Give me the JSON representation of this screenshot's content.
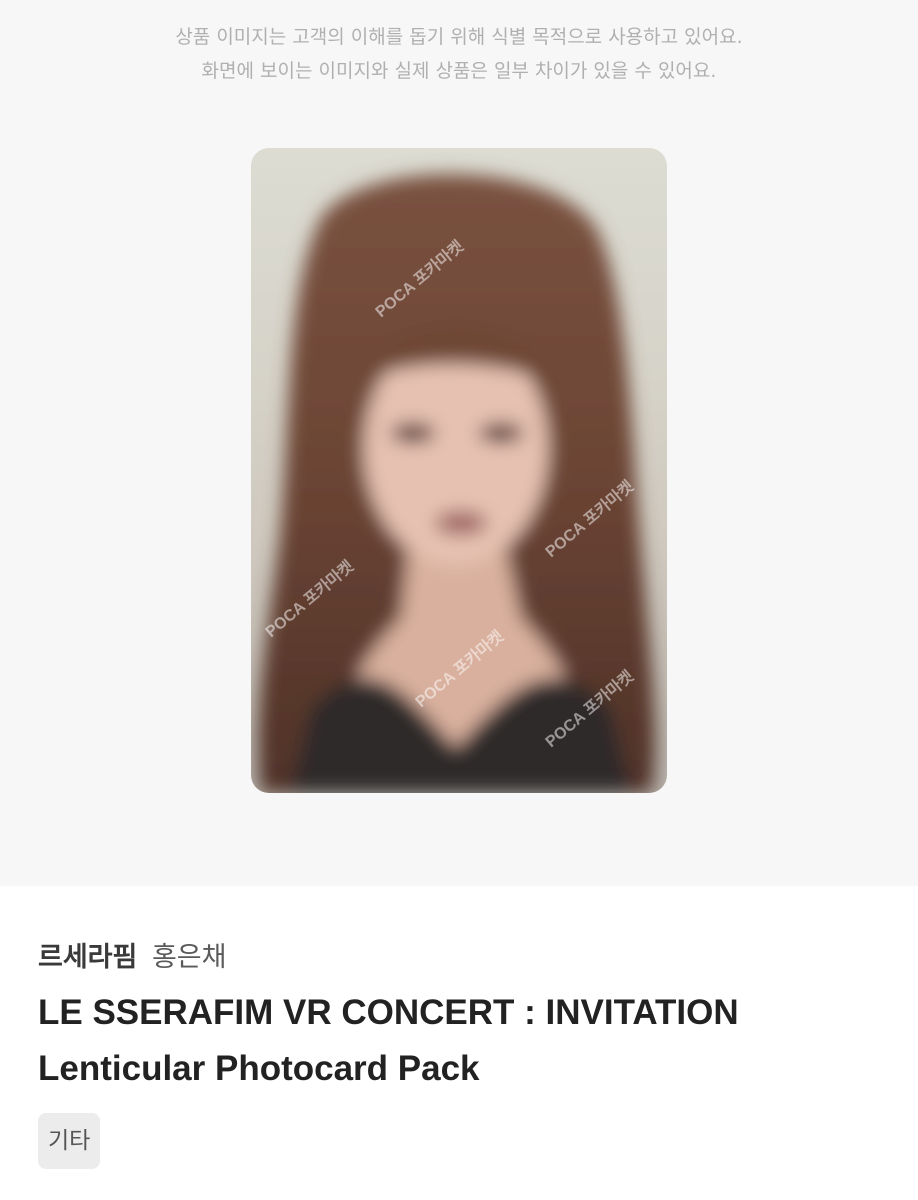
{
  "notice": {
    "line1": "상품 이미지는 고객의 이해를 돕기 위해 식별 목적으로 사용하고 있어요.",
    "line2": "화면에 보이는 이미지와 실제 상품은 일부 차이가 있을 수 있어요."
  },
  "product_image": {
    "watermark": "POCA 포카마켓"
  },
  "product": {
    "group": "르세라핌",
    "member": "홍은채",
    "title_line1": "LE SSERAFIM VR CONCERT : INVITATION",
    "title_line2": "Lenticular Photocard Pack",
    "tag": "기타"
  }
}
